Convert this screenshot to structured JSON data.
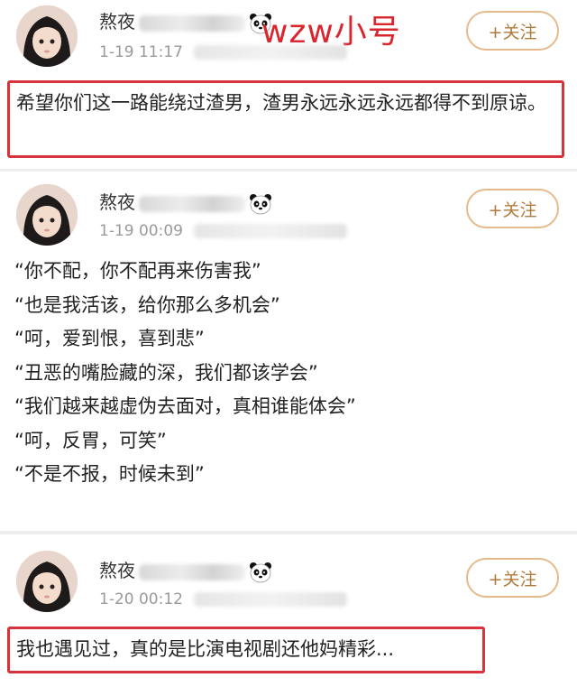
{
  "posts": [
    {
      "username": "熬夜",
      "tag": "wzw小号",
      "time": "1-19 11:17",
      "follow_label": "+关注",
      "text": "希望你们这一路能绕过渣男，渣男永远永远永远都得不到原谅。"
    },
    {
      "username": "熬夜",
      "time": "1-19 00:09",
      "follow_label": "+关注",
      "lines": [
        "“你不配，你不配再来伤害我”",
        "“也是我活该，给你那么多机会”",
        "“呵，爱到恨，喜到悲”",
        "“丑恶的嘴脸藏的深，我们都该学会”",
        "“我们越来越虚伪去面对，真相谁能体会”",
        "“呵，反胃，可笑”",
        "“不是不报，时候未到”"
      ]
    },
    {
      "username": "熬夜",
      "time": "1-20 00:12",
      "follow_label": "+关注",
      "text": "我也遇见过，真的是比演电视剧还他妈精彩..."
    }
  ],
  "colors": {
    "highlight": "#d8333a",
    "tag": "#d8262e",
    "follow_border": "#e7ba8b",
    "follow_text": "#b07a3c"
  },
  "icons": [
    "panda-emoji-icon",
    "avatar-girl"
  ]
}
